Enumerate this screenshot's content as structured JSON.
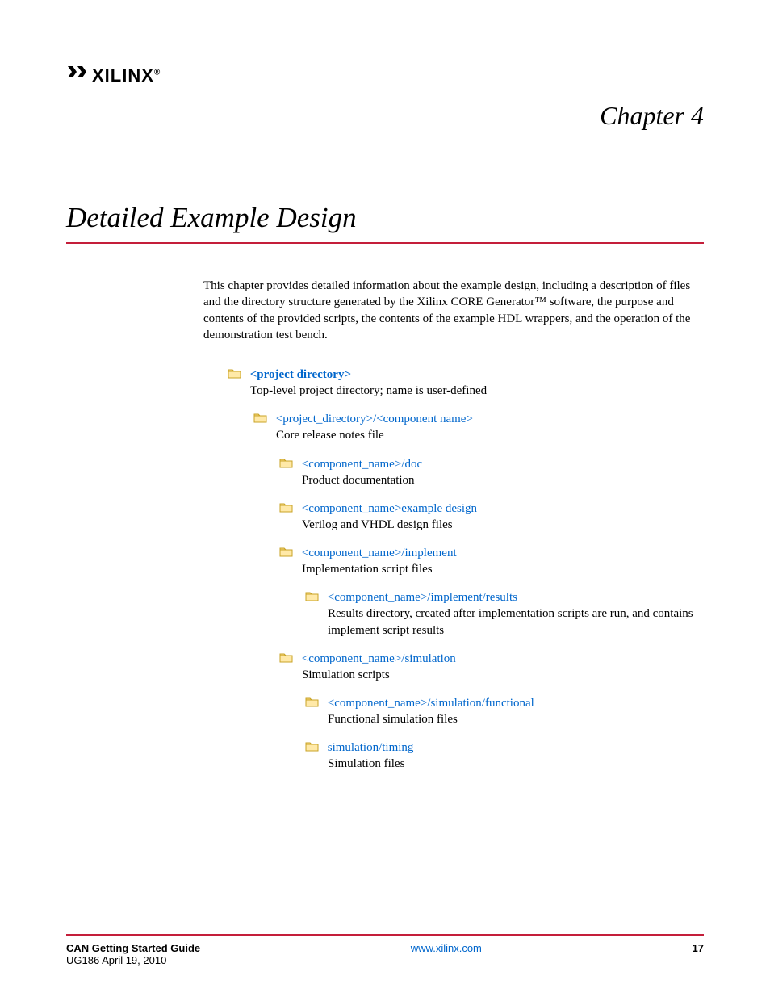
{
  "logo": {
    "text": "XILINX",
    "reg": "®"
  },
  "chapter_label": "Chapter 4",
  "chapter_title": "Detailed Example Design",
  "intro": "This chapter provides detailed information about the example design, including a description of files and the directory structure generated by the Xilinx CORE Generator™ software, the purpose and contents of the provided scripts, the contents of the example HDL wrappers, and the operation of the demonstration test bench.",
  "tree": {
    "root": {
      "link": "<project directory>",
      "desc": "Top-level project directory; name is user-defined"
    },
    "component": {
      "link": "<project_directory>/<component name>",
      "desc": "Core release notes file"
    },
    "doc": {
      "link": "<component_name>/doc",
      "desc": "Product documentation"
    },
    "example": {
      "link": "<component_name>example design",
      "desc": "Verilog and VHDL design files"
    },
    "implement": {
      "link": "<component_name>/implement",
      "desc": "Implementation script files"
    },
    "results": {
      "link": "<component_name>/implement/results",
      "desc": "Results directory, created after implementation scripts are run, and contains implement script results"
    },
    "simulation": {
      "link": "<component_name>/simulation",
      "desc": "Simulation scripts"
    },
    "functional": {
      "link": "<component_name>/simulation/functional",
      "desc": "Functional simulation files"
    },
    "timing": {
      "link": "simulation/timing",
      "desc": "Simulation files"
    }
  },
  "footer": {
    "title": "CAN Getting Started Guide",
    "sub": "UG186 April 19, 2010",
    "url": "www.xilinx.com",
    "page": "17"
  }
}
